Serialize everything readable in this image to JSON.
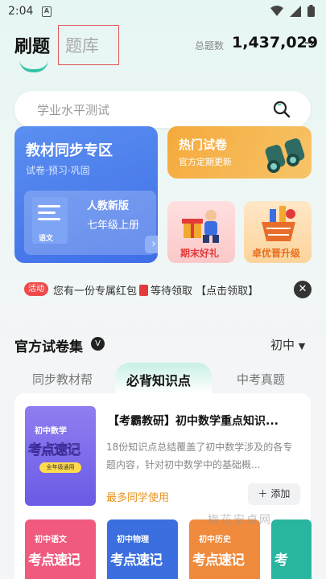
{
  "status_bar": {
    "time": "2:04",
    "notification": "A"
  },
  "header": {
    "active_tab": "刷题",
    "inactive_tab": "题库",
    "total_label": "总题数",
    "total_value": "1,437,029",
    "total_arrow": "→"
  },
  "search": {
    "placeholder": "学业水平测试"
  },
  "sync_card": {
    "title": "教材同步专区",
    "subtitle": "试卷·预习·巩固",
    "book_label": "语文",
    "edition": "人教新版",
    "grade": "七年级上册"
  },
  "hot_card": {
    "title": "热门试卷",
    "subtitle": "官方定期更新"
  },
  "gift_card": {
    "label": "期末好礼"
  },
  "boost_card": {
    "label": "卓优晋升级"
  },
  "promo": {
    "tag": "活动",
    "text_before": "您有一份专属红包",
    "text_after": "等待领取 【点击领取】"
  },
  "section": {
    "title": "官方试卷集",
    "badge": "V",
    "level": "初中"
  },
  "tabs": [
    {
      "label": "同步教材帮"
    },
    {
      "label": "必背知识点"
    },
    {
      "label": "中考真题"
    }
  ],
  "list": {
    "item_title": "【考霸教研】初中数学重点知识...",
    "item_desc": "18份知识点总结覆盖了初中数学涉及的各专题内容，针对初中数学中的基础概...",
    "item_hint": "最多同学使用",
    "add_label": "添加",
    "cover_subject": "初中数学",
    "cover_main": "考点速记",
    "cover_pill": "全年级通用",
    "more_covers": [
      {
        "subject": "初中语文",
        "main": "考点速记",
        "color": "#f05a7e"
      },
      {
        "subject": "初中物理",
        "main": "考点速记",
        "color": "#3b6fe0"
      },
      {
        "subject": "初中历史",
        "main": "考点速记",
        "color": "#f08a3c"
      },
      {
        "subject": "",
        "main": "考",
        "color": "#29b6a0"
      }
    ]
  },
  "watermark": "梅花安卓网",
  "colors": {
    "accent": "#35c3a6",
    "sync_blue": "#3f6ee8",
    "hot_orange": "#f5a93b",
    "promo_red": "#ee4a4a"
  }
}
